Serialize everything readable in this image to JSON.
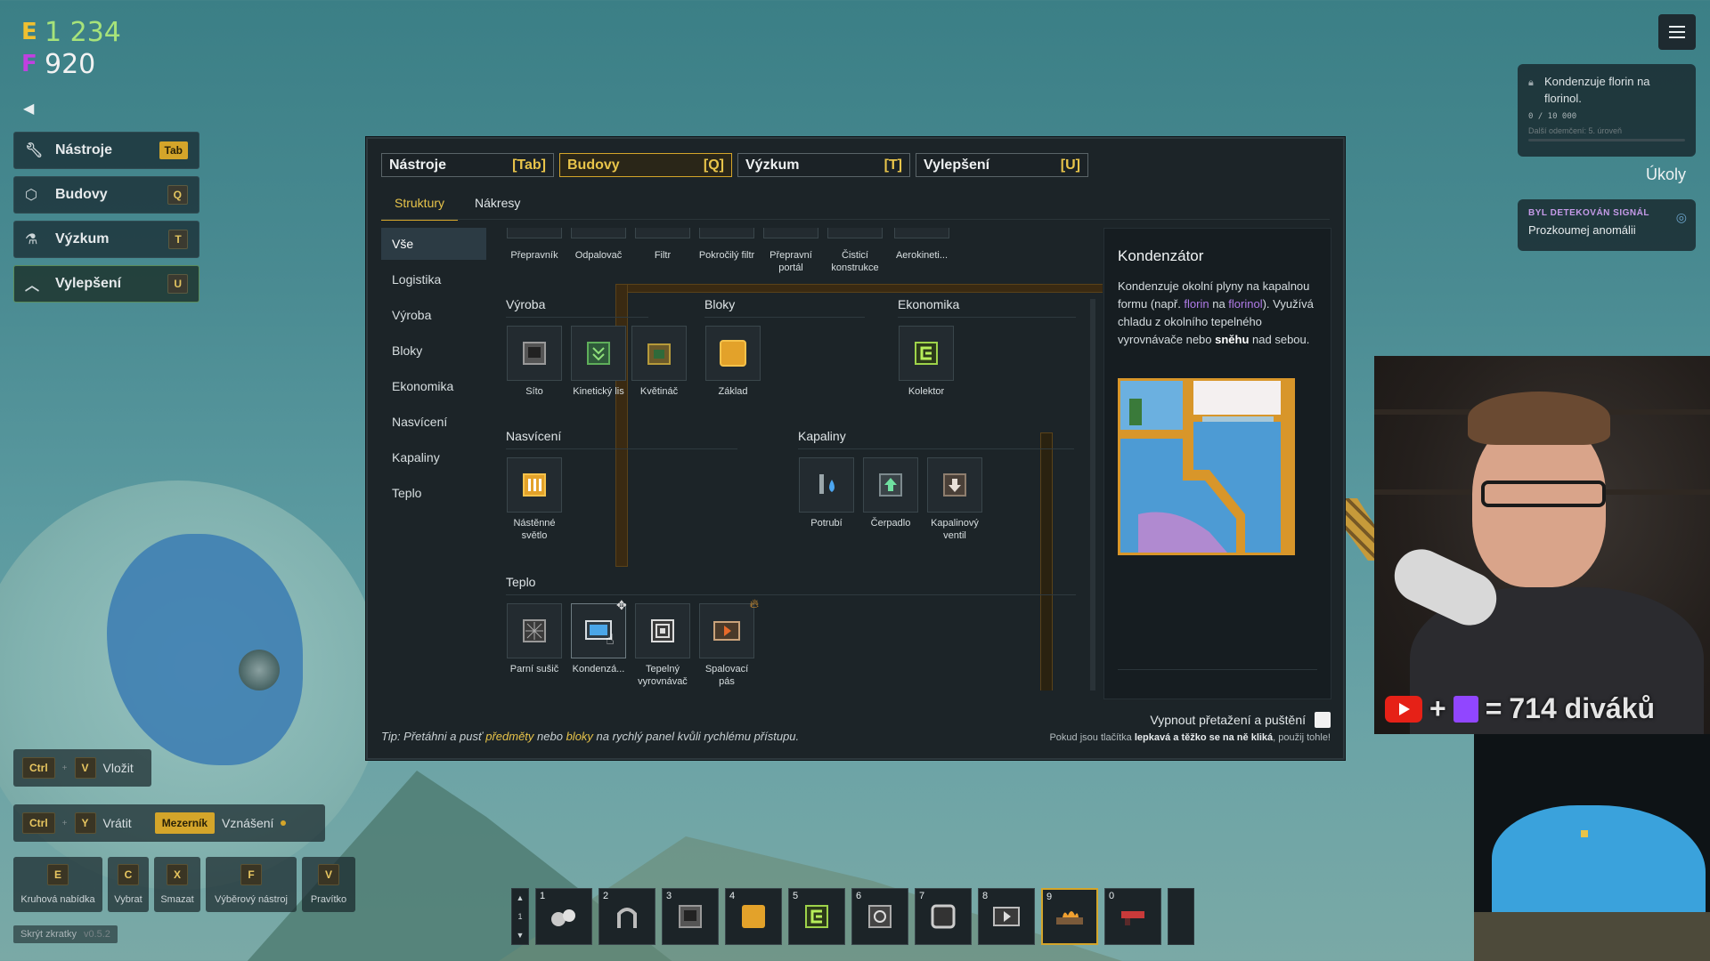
{
  "currency": {
    "e_value": "1 234",
    "f_value": "920",
    "e_icon": "energy-e-icon",
    "f_icon": "florin-f-icon"
  },
  "left_menu": [
    {
      "label": "Nástroje",
      "key": "Tab",
      "icon": "wrench-icon"
    },
    {
      "label": "Budovy",
      "key": "Q",
      "icon": "cube-icon"
    },
    {
      "label": "Výzkum",
      "key": "T",
      "icon": "flask-icon"
    },
    {
      "label": "Vylepšení",
      "key": "U",
      "icon": "chevron-up-icon"
    }
  ],
  "shortcuts": {
    "paste": {
      "k1": "Ctrl",
      "k2": "V",
      "label": "Vložit"
    },
    "undo": {
      "k1": "Ctrl",
      "k2": "Y",
      "label": "Vrátit"
    },
    "hover": {
      "k": "Mezerník",
      "label": "Vznášení"
    },
    "tools": [
      {
        "key": "E",
        "label": "Kruhová nabídka"
      },
      {
        "key": "C",
        "label": "Vybrat"
      },
      {
        "key": "X",
        "label": "Smazat"
      },
      {
        "key": "F",
        "label": "Výběrový nástroj"
      },
      {
        "key": "V",
        "label": "Pravítko"
      }
    ],
    "hide": "Skrýt zkratky",
    "version": "v0.5.2"
  },
  "panel": {
    "tabs": [
      {
        "label": "Nástroje",
        "key": "[Tab]"
      },
      {
        "label": "Budovy",
        "key": "[Q]"
      },
      {
        "label": "Výzkum",
        "key": "[T]"
      },
      {
        "label": "Vylepšení",
        "key": "[U]"
      }
    ],
    "subtabs": [
      "Struktury",
      "Nákresy"
    ],
    "categories": [
      "Vše",
      "Logistika",
      "Výroba",
      "Bloky",
      "Ekonomika",
      "Nasvícení",
      "Kapaliny",
      "Teplo"
    ],
    "top_items": [
      {
        "name": "Přepravník"
      },
      {
        "name": "Odpalovač"
      },
      {
        "name": "Filtr"
      },
      {
        "name": "Pokročilý filtr"
      },
      {
        "name": "Přepravní portál"
      },
      {
        "name": "Čisticí konstrukce"
      },
      {
        "name": "Aerokineti..."
      }
    ],
    "sections": {
      "vyroba": {
        "title": "Výroba",
        "items": [
          "Síto",
          "Kinetický lis",
          "Květináč"
        ]
      },
      "bloky": {
        "title": "Bloky",
        "items": [
          "Základ"
        ]
      },
      "ekonomika": {
        "title": "Ekonomika",
        "items": [
          "Kolektor"
        ]
      },
      "nasviceni": {
        "title": "Nasvícení",
        "items": [
          "Nástěnné světlo"
        ]
      },
      "kapaliny": {
        "title": "Kapaliny",
        "items": [
          "Potrubí",
          "Čerpadlo",
          "Kapalinový ventil"
        ]
      },
      "teplo": {
        "title": "Teplo",
        "items": [
          "Parní sušič",
          "Kondenzá...",
          "Tepelný vyrovnávač",
          "Spalovací pás"
        ]
      }
    },
    "detail": {
      "title": "Kondenzátor",
      "text1": "Kondenzuje okolní plyny na kapalnou formu (např. ",
      "florin": "florin",
      "text2": " na ",
      "florinol": "florinol",
      "text3": "). Využívá chladu z okolního tepelného vyrovnávače nebo ",
      "snow": "sněhu",
      "text4": " nad sebou."
    },
    "toggle_label": "Vypnout přetažení a puštění",
    "tip": {
      "prefix": "Tip: Přetáhni a pusť ",
      "items": "předměty",
      "mid": " nebo ",
      "blocks": "bloky",
      "suffix": " na rychlý panel kvůli rychlému přístupu."
    },
    "hint": {
      "prefix": "Pokud jsou tlačítka ",
      "bold": "lepkavá a těžko se na ně kliká",
      "suffix": ", použij tohle!"
    }
  },
  "right": {
    "quest_text": "Kondenzuje florin na florinol.",
    "quest_progress": "0 / 10 000",
    "quest_next": "Další odemčení: 5. úroveň",
    "tasks_label": "Úkoly",
    "signal_title": "BYL DETEKOVÁN SIGNÁL",
    "signal_text": "Prozkoumej anomálii"
  },
  "stream": {
    "viewers": "714 diváků",
    "plus": "+",
    "equals": "="
  },
  "hotbar": {
    "side": [
      "▲",
      "1",
      "▼"
    ],
    "slots": [
      {
        "n": "1",
        "icon": "rocks-icon"
      },
      {
        "n": "2",
        "icon": "claw-icon"
      },
      {
        "n": "3",
        "icon": "sieve-icon"
      },
      {
        "n": "4",
        "icon": "gold-block-icon"
      },
      {
        "n": "5",
        "icon": "collector-icon"
      },
      {
        "n": "6",
        "icon": "machine-icon"
      },
      {
        "n": "7",
        "icon": "frame-icon"
      },
      {
        "n": "8",
        "icon": "dryer-icon"
      },
      {
        "n": "9",
        "icon": "burner-belt-icon"
      },
      {
        "n": "0",
        "icon": "gun-icon"
      }
    ],
    "active_slot": "9"
  }
}
